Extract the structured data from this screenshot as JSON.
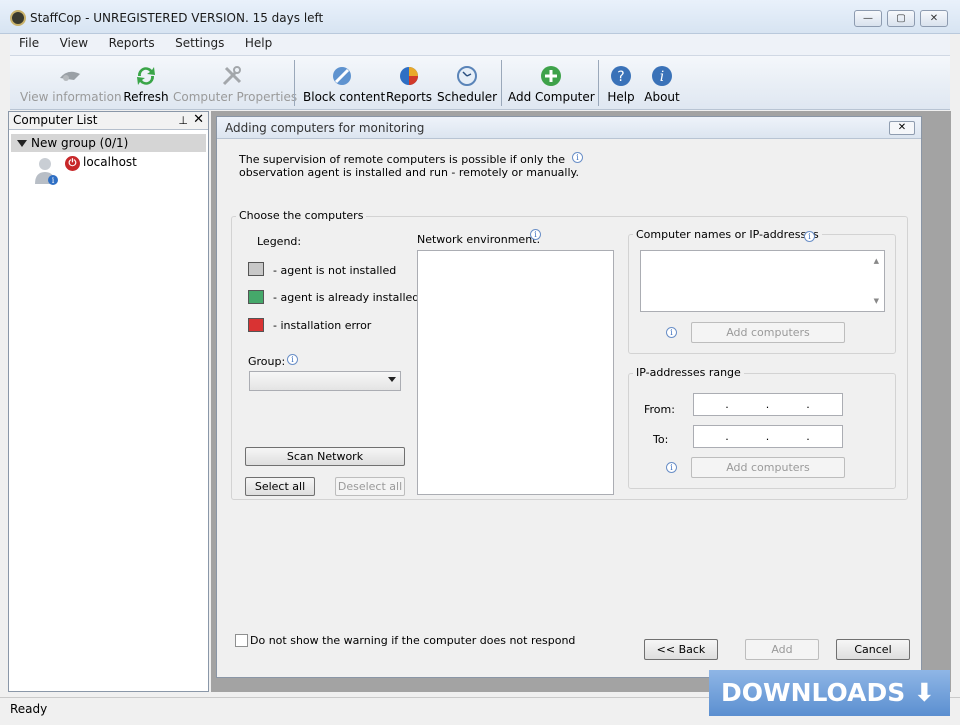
{
  "window": {
    "title": "StaffCop - UNREGISTERED VERSION. 15 days left",
    "minimize": "—",
    "maximize": "▢",
    "close": "✕"
  },
  "menu": [
    "File",
    "View",
    "Reports",
    "Settings",
    "Help"
  ],
  "toolbar": {
    "view_information": "View information",
    "refresh": "Refresh",
    "computer_properties": "Computer Properties",
    "block_content": "Block content",
    "reports": "Reports",
    "scheduler": "Scheduler",
    "add_computer": "Add Computer",
    "help": "Help",
    "about": "About"
  },
  "computer_list": {
    "title": "Computer List",
    "pin": "⊥",
    "close": "✕",
    "group": "New group (0/1)",
    "host": "localhost"
  },
  "dialog": {
    "title": "Adding computers for monitoring",
    "close": "✕",
    "intro_line1": "The supervision of remote computers is possible if only the",
    "intro_line2": "observation agent is installed and run - remotely or manually.",
    "choose_title": "Choose the computers",
    "legend_title": "Legend:",
    "legend": [
      "- agent is not installed",
      "- agent is already installed",
      "- installation error"
    ],
    "group_label": "Group:",
    "group_value": "",
    "scan_network": "Scan Network",
    "select_all": "Select all",
    "deselect_all": "Deselect all",
    "network_env": "Network environment:",
    "names_title": "Computer names or IP-addresses",
    "names_value": "",
    "add_computers": "Add computers",
    "range_title": "IP-addresses range",
    "from_label": "From:",
    "to_label": "To:",
    "from_value": ".        .        .",
    "to_value": ".        .        .",
    "dont_show": "Do not show the warning if the computer does not respond",
    "back": "<< Back",
    "add": "Add",
    "cancel": "Cancel"
  },
  "status": "Ready",
  "watermark": "DOWNLOADS ⬇ GURU",
  "colors": {
    "legend_not_installed": "#8a8a8a",
    "legend_installed": "#2e9b57",
    "legend_error": "#d22b2b"
  }
}
